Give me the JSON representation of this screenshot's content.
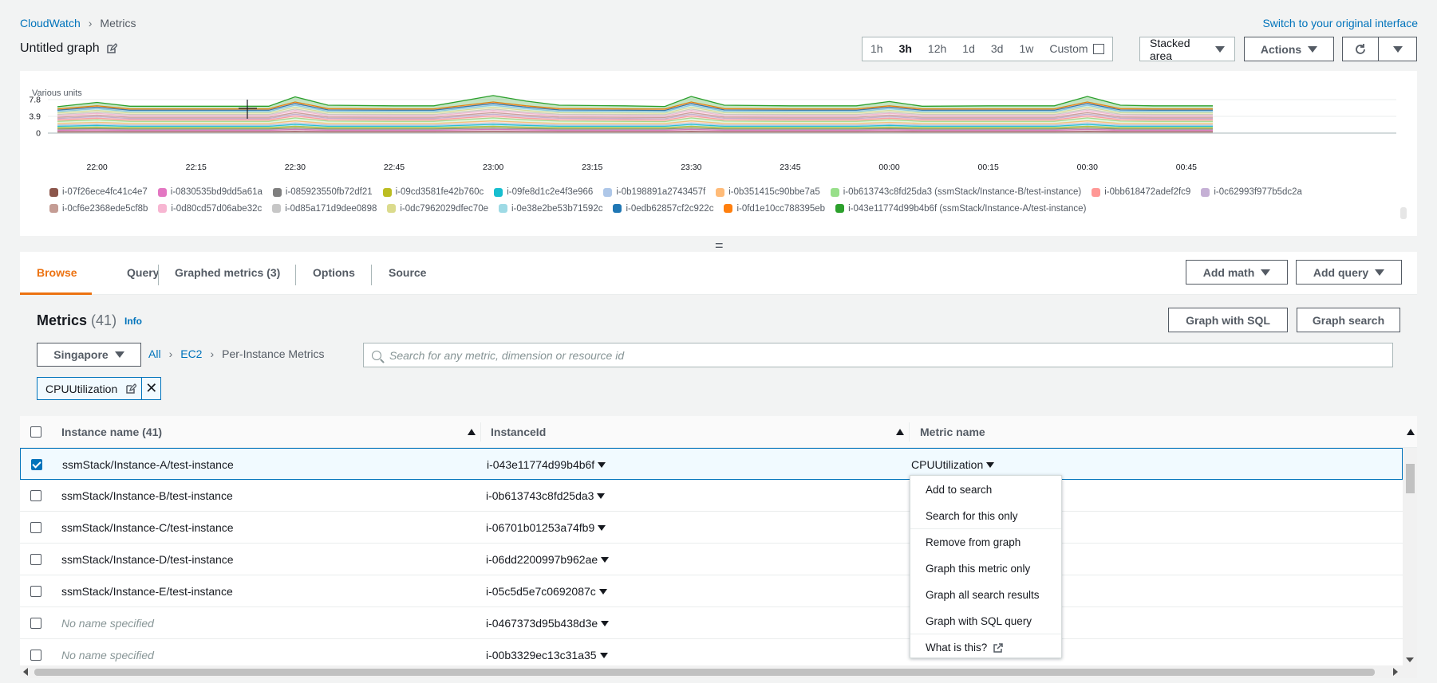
{
  "breadcrumb": {
    "root": "CloudWatch",
    "current": "Metrics"
  },
  "switch_link": "Switch to your original interface",
  "graph_title": "Untitled graph",
  "time_ranges": [
    "1h",
    "3h",
    "12h",
    "1d",
    "3d",
    "1w"
  ],
  "time_range_selected": "3h",
  "custom_label": "Custom",
  "chart_type": "Stacked area",
  "actions_label": "Actions",
  "chart": {
    "units_label": "Various units",
    "y_ticks": [
      "7.8",
      "3.9",
      "0"
    ],
    "x_ticks": [
      "22:00",
      "22:15",
      "22:30",
      "22:45",
      "23:00",
      "23:15",
      "23:30",
      "23:45",
      "00:00",
      "00:15",
      "00:30",
      "00:45"
    ]
  },
  "chart_data": {
    "type": "area",
    "stacked": true,
    "ylim": [
      0,
      7.8
    ],
    "x": [
      "21:54",
      "22:00",
      "22:05",
      "22:15",
      "22:26",
      "22:30",
      "22:35",
      "22:45",
      "22:51",
      "23:00",
      "23:05",
      "23:10",
      "23:20",
      "23:26",
      "23:30",
      "23:35",
      "23:45",
      "23:55",
      "00:00",
      "00:05",
      "00:15",
      "00:20",
      "00:25",
      "00:30",
      "00:35",
      "00:40",
      "00:45",
      "00:49"
    ],
    "series": [
      {
        "name": "i-07f26ece4fc41c4e7",
        "color": "#8c564b",
        "values": [
          0.3,
          0.35,
          0.3,
          0.3,
          0.3,
          0.4,
          0.3,
          0.3,
          0.3,
          0.4,
          0.35,
          0.3,
          0.3,
          0.3,
          0.4,
          0.3,
          0.3,
          0.3,
          0.35,
          0.3,
          0.3,
          0.3,
          0.3,
          0.4,
          0.3,
          0.3,
          0.3,
          0.3
        ]
      },
      {
        "name": "i-0830535bd9dd5a61a",
        "color": "#e377c2",
        "values": [
          0.35,
          0.4,
          0.35,
          0.35,
          0.35,
          0.45,
          0.35,
          0.35,
          0.35,
          0.45,
          0.4,
          0.35,
          0.35,
          0.35,
          0.45,
          0.35,
          0.35,
          0.35,
          0.4,
          0.35,
          0.35,
          0.35,
          0.35,
          0.45,
          0.35,
          0.35,
          0.35,
          0.35
        ]
      },
      {
        "name": "i-085923550fb72df21",
        "color": "#7f7f7f",
        "values": [
          0.3,
          0.3,
          0.3,
          0.3,
          0.3,
          0.35,
          0.3,
          0.3,
          0.3,
          0.35,
          0.3,
          0.3,
          0.3,
          0.3,
          0.35,
          0.3,
          0.3,
          0.3,
          0.3,
          0.3,
          0.3,
          0.3,
          0.3,
          0.35,
          0.3,
          0.3,
          0.3,
          0.3
        ]
      },
      {
        "name": "i-09cd3581fe42b760c",
        "color": "#bcbd22",
        "values": [
          0.3,
          0.35,
          0.3,
          0.3,
          0.3,
          0.4,
          0.3,
          0.3,
          0.3,
          0.4,
          0.35,
          0.3,
          0.3,
          0.3,
          0.4,
          0.3,
          0.3,
          0.3,
          0.35,
          0.3,
          0.3,
          0.3,
          0.3,
          0.4,
          0.3,
          0.3,
          0.3,
          0.3
        ]
      },
      {
        "name": "i-09fe8d1c2e4f3e966",
        "color": "#17becf",
        "values": [
          0.35,
          0.4,
          0.35,
          0.35,
          0.35,
          0.45,
          0.35,
          0.35,
          0.35,
          0.45,
          0.4,
          0.35,
          0.35,
          0.35,
          0.45,
          0.35,
          0.35,
          0.35,
          0.4,
          0.35,
          0.35,
          0.35,
          0.35,
          0.45,
          0.35,
          0.35,
          0.35,
          0.35
        ]
      },
      {
        "name": "i-0b198891a2743457f",
        "color": "#aec7e8",
        "values": [
          0.3,
          0.3,
          0.3,
          0.3,
          0.3,
          0.35,
          0.3,
          0.3,
          0.3,
          0.35,
          0.3,
          0.3,
          0.3,
          0.3,
          0.35,
          0.3,
          0.3,
          0.3,
          0.3,
          0.3,
          0.3,
          0.3,
          0.3,
          0.35,
          0.3,
          0.3,
          0.3,
          0.3
        ]
      },
      {
        "name": "i-0b351415c90bbe7a5",
        "color": "#ffbb78",
        "values": [
          0.35,
          0.4,
          0.35,
          0.35,
          0.35,
          0.45,
          0.35,
          0.35,
          0.35,
          0.45,
          0.4,
          0.35,
          0.35,
          0.35,
          0.45,
          0.35,
          0.35,
          0.35,
          0.4,
          0.35,
          0.35,
          0.35,
          0.35,
          0.45,
          0.35,
          0.35,
          0.35,
          0.35
        ]
      },
      {
        "name": "i-0b613743c8fd25da3 (ssmStack/Instance-B/test-instance)",
        "color": "#98df8a",
        "values": [
          0.5,
          0.6,
          0.5,
          0.5,
          0.5,
          0.7,
          0.55,
          0.5,
          0.5,
          0.7,
          0.6,
          0.55,
          0.5,
          0.45,
          0.7,
          0.55,
          0.5,
          0.5,
          0.6,
          0.5,
          0.5,
          0.5,
          0.5,
          0.7,
          0.55,
          0.5,
          0.5,
          0.5
        ]
      },
      {
        "name": "i-0bb618472adef2fc9",
        "color": "#ff9896",
        "values": [
          0.35,
          0.4,
          0.35,
          0.35,
          0.35,
          0.45,
          0.35,
          0.35,
          0.35,
          0.45,
          0.4,
          0.35,
          0.35,
          0.35,
          0.45,
          0.35,
          0.35,
          0.35,
          0.4,
          0.35,
          0.35,
          0.35,
          0.35,
          0.45,
          0.35,
          0.35,
          0.35,
          0.35
        ]
      },
      {
        "name": "i-0c62993f977b5dc2a",
        "color": "#c5b0d5",
        "values": [
          0.3,
          0.35,
          0.3,
          0.3,
          0.3,
          0.4,
          0.3,
          0.3,
          0.3,
          0.4,
          0.35,
          0.3,
          0.3,
          0.3,
          0.4,
          0.3,
          0.3,
          0.3,
          0.35,
          0.3,
          0.3,
          0.3,
          0.3,
          0.4,
          0.3,
          0.3,
          0.3,
          0.3
        ]
      },
      {
        "name": "i-0cf6e2368ede5cf8b",
        "color": "#c49c94",
        "values": [
          0.3,
          0.35,
          0.3,
          0.3,
          0.3,
          0.4,
          0.3,
          0.3,
          0.3,
          0.4,
          0.35,
          0.3,
          0.3,
          0.3,
          0.4,
          0.3,
          0.3,
          0.3,
          0.35,
          0.3,
          0.3,
          0.3,
          0.3,
          0.4,
          0.3,
          0.3,
          0.3,
          0.3
        ]
      },
      {
        "name": "i-0d80cd57d06abe32c",
        "color": "#f7b6d2",
        "values": [
          0.35,
          0.4,
          0.35,
          0.35,
          0.35,
          0.45,
          0.35,
          0.35,
          0.35,
          0.45,
          0.4,
          0.35,
          0.35,
          0.35,
          0.45,
          0.35,
          0.35,
          0.35,
          0.4,
          0.35,
          0.35,
          0.35,
          0.35,
          0.45,
          0.35,
          0.35,
          0.35,
          0.35
        ]
      },
      {
        "name": "i-0d85a171d9dee0898",
        "color": "#c7c7c7",
        "values": [
          0.3,
          0.3,
          0.3,
          0.3,
          0.3,
          0.35,
          0.3,
          0.3,
          0.3,
          0.35,
          0.3,
          0.3,
          0.3,
          0.3,
          0.35,
          0.3,
          0.3,
          0.3,
          0.3,
          0.3,
          0.3,
          0.3,
          0.3,
          0.35,
          0.3,
          0.3,
          0.3,
          0.3
        ]
      },
      {
        "name": "i-0dc7962029dfec70e",
        "color": "#dbdb8d",
        "values": [
          0.35,
          0.4,
          0.35,
          0.35,
          0.35,
          0.45,
          0.35,
          0.35,
          0.35,
          0.45,
          0.4,
          0.35,
          0.35,
          0.35,
          0.45,
          0.35,
          0.35,
          0.35,
          0.4,
          0.35,
          0.35,
          0.35,
          0.35,
          0.45,
          0.35,
          0.35,
          0.35,
          0.35
        ]
      },
      {
        "name": "i-0e38e2be53b71592c",
        "color": "#9edae5",
        "values": [
          0.3,
          0.35,
          0.3,
          0.3,
          0.3,
          0.4,
          0.3,
          0.3,
          0.3,
          0.4,
          0.35,
          0.3,
          0.3,
          0.3,
          0.4,
          0.3,
          0.3,
          0.3,
          0.35,
          0.3,
          0.3,
          0.3,
          0.3,
          0.4,
          0.3,
          0.3,
          0.3,
          0.3
        ]
      },
      {
        "name": "i-0edb62857cf2c922c",
        "color": "#1f77b4",
        "values": [
          0.35,
          0.4,
          0.35,
          0.35,
          0.35,
          0.45,
          0.35,
          0.35,
          0.35,
          0.45,
          0.4,
          0.35,
          0.35,
          0.35,
          0.45,
          0.35,
          0.35,
          0.35,
          0.4,
          0.35,
          0.35,
          0.35,
          0.35,
          0.45,
          0.35,
          0.35,
          0.35,
          0.35
        ]
      },
      {
        "name": "i-0fd1e10cc788395eb",
        "color": "#ff7f0e",
        "values": [
          0.3,
          0.3,
          0.3,
          0.3,
          0.3,
          0.35,
          0.3,
          0.3,
          0.3,
          0.35,
          0.3,
          0.3,
          0.3,
          0.3,
          0.35,
          0.3,
          0.3,
          0.3,
          0.3,
          0.3,
          0.3,
          0.3,
          0.3,
          0.35,
          0.3,
          0.3,
          0.3,
          0.3
        ]
      },
      {
        "name": "i-043e11774d99b4b6f (ssmStack/Instance-A/test-instance)",
        "color": "#2ca02c",
        "values": [
          0.5,
          0.8,
          0.6,
          0.6,
          0.6,
          1.2,
          0.8,
          0.7,
          0.7,
          1.5,
          1.1,
          0.8,
          0.7,
          0.6,
          1.3,
          0.8,
          0.7,
          0.7,
          1.0,
          0.6,
          0.7,
          0.7,
          0.7,
          1.3,
          0.8,
          0.7,
          0.7,
          0.7
        ]
      }
    ]
  },
  "tabs": [
    {
      "label": "Browse"
    },
    {
      "label": "Query"
    },
    {
      "label": "Graphed metrics (3)"
    },
    {
      "label": "Options"
    },
    {
      "label": "Source"
    }
  ],
  "add_math_label": "Add math",
  "add_query_label": "Add query",
  "metrics_header": {
    "title": "Metrics",
    "count": "(41)",
    "info": "Info"
  },
  "graph_with_sql_label": "Graph with SQL",
  "graph_search_label": "Graph search",
  "region": "Singapore",
  "path": {
    "all": "All",
    "ec2": "EC2",
    "current": "Per-Instance Metrics"
  },
  "search_placeholder": "Search for any metric, dimension or resource id",
  "token_label": "CPUUtilization",
  "table": {
    "headers": {
      "name": "Instance name (41)",
      "id": "InstanceId",
      "metric": "Metric name"
    },
    "rows": [
      {
        "name": "ssmStack/Instance-A/test-instance",
        "id": "i-043e11774d99b4b6f",
        "metric": "CPUUtilization",
        "checked": true
      },
      {
        "name": "ssmStack/Instance-B/test-instance",
        "id": "i-0b613743c8fd25da3",
        "metric": "",
        "checked": false
      },
      {
        "name": "ssmStack/Instance-C/test-instance",
        "id": "i-06701b01253a74fb9",
        "metric": "",
        "checked": false
      },
      {
        "name": "ssmStack/Instance-D/test-instance",
        "id": "i-06dd2200997b962ae",
        "metric": "",
        "checked": false
      },
      {
        "name": "ssmStack/Instance-E/test-instance",
        "id": "i-05c5d5e7c0692087c",
        "metric": "",
        "checked": false
      },
      {
        "name": "No name specified",
        "id": "i-0467373d95b438d3e",
        "metric": "",
        "checked": false
      },
      {
        "name": "No name specified",
        "id": "i-00b3329ec13c31a35",
        "metric": "",
        "checked": false
      }
    ]
  },
  "context_menu": [
    "Add to search",
    "Search for this only",
    "Remove from graph",
    "Graph this metric only",
    "Graph all search results",
    "Graph with SQL query",
    "What is this?"
  ]
}
